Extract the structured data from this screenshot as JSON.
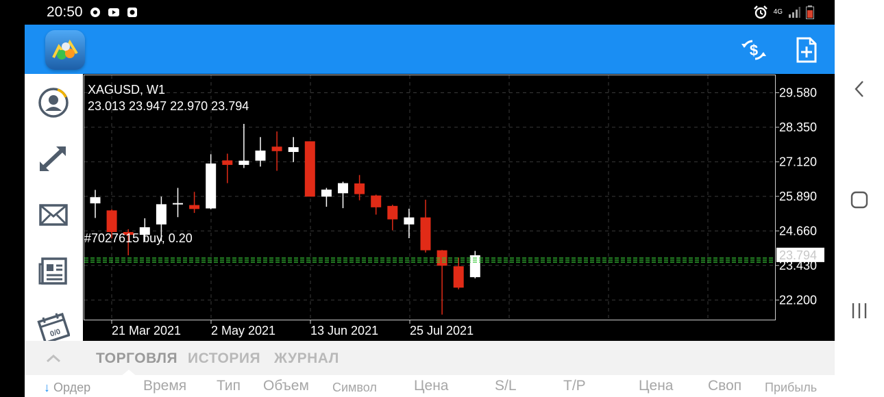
{
  "statusbar": {
    "time": "20:50",
    "network": "4G"
  },
  "chart": {
    "symbol_title": "XAGUSD, W1",
    "ohlc_line": "23.013 23.947 22.970 23.794",
    "order_label": "#7027615 buy, 0.20",
    "current_price": "23.794",
    "price_ticks": [
      "29.580",
      "28.350",
      "27.120",
      "25.890",
      "24.660",
      "23.430",
      "22.200"
    ],
    "date_ticks": [
      "21 Mar 2021",
      "2 May 2021",
      "13 Jun 2021",
      "25 Jul 2021"
    ],
    "colors": {
      "bull": "#ffffff",
      "bear": "#e12b17",
      "level": "#37c837",
      "grid": "#3a3a3a"
    }
  },
  "chart_data": {
    "type": "candlestick",
    "title": "XAGUSD, W1",
    "ylim": [
      21.5,
      30.2
    ],
    "order_level": 23.62,
    "candles": [
      {
        "o": 25.64,
        "h": 26.12,
        "l": 25.12,
        "c": 25.86
      },
      {
        "o": 25.39,
        "h": 25.43,
        "l": 24.39,
        "c": 24.62
      },
      {
        "o": 24.62,
        "h": 24.72,
        "l": 23.79,
        "c": 24.52
      },
      {
        "o": 24.52,
        "h": 25.11,
        "l": 24.29,
        "c": 24.79
      },
      {
        "o": 24.89,
        "h": 25.88,
        "l": 24.29,
        "c": 25.61
      },
      {
        "o": 25.61,
        "h": 26.19,
        "l": 25.15,
        "c": 25.65
      },
      {
        "o": 25.58,
        "h": 26.05,
        "l": 25.3,
        "c": 25.44
      },
      {
        "o": 25.46,
        "h": 27.39,
        "l": 25.43,
        "c": 27.06
      },
      {
        "o": 27.17,
        "h": 27.41,
        "l": 26.36,
        "c": 27.01
      },
      {
        "o": 27.01,
        "h": 28.47,
        "l": 26.9,
        "c": 27.16
      },
      {
        "o": 27.16,
        "h": 28.0,
        "l": 26.95,
        "c": 27.52
      },
      {
        "o": 27.66,
        "h": 28.2,
        "l": 26.8,
        "c": 27.5
      },
      {
        "o": 27.47,
        "h": 28.0,
        "l": 27.11,
        "c": 27.64
      },
      {
        "o": 27.85,
        "h": 27.85,
        "l": 25.9,
        "c": 25.88
      },
      {
        "o": 25.88,
        "h": 26.19,
        "l": 25.52,
        "c": 26.13
      },
      {
        "o": 26.0,
        "h": 26.41,
        "l": 25.47,
        "c": 26.36
      },
      {
        "o": 26.35,
        "h": 26.65,
        "l": 25.75,
        "c": 25.97
      },
      {
        "o": 25.92,
        "h": 25.95,
        "l": 25.24,
        "c": 25.5
      },
      {
        "o": 25.55,
        "h": 25.59,
        "l": 24.68,
        "c": 25.07
      },
      {
        "o": 24.89,
        "h": 25.45,
        "l": 24.4,
        "c": 25.14
      },
      {
        "o": 25.14,
        "h": 25.77,
        "l": 23.89,
        "c": 23.97
      },
      {
        "o": 23.97,
        "h": 23.98,
        "l": 21.68,
        "c": 23.42
      },
      {
        "o": 23.4,
        "h": 23.71,
        "l": 22.58,
        "c": 22.64
      },
      {
        "o": 23.013,
        "h": 23.947,
        "l": 22.97,
        "c": 23.794
      }
    ]
  },
  "bottom": {
    "tabs": [
      "ТОРГОВЛЯ",
      "ИСТОРИЯ",
      "ЖУРНАЛ"
    ],
    "headers": {
      "order": "Ордер",
      "time": "Время",
      "type": "Тип",
      "volume": "Объем",
      "symbol": "Символ",
      "price": "Цена",
      "sl": "S/L",
      "tp": "T/P",
      "price2": "Цена",
      "swap": "Своп",
      "profit": "Прибыль"
    }
  }
}
